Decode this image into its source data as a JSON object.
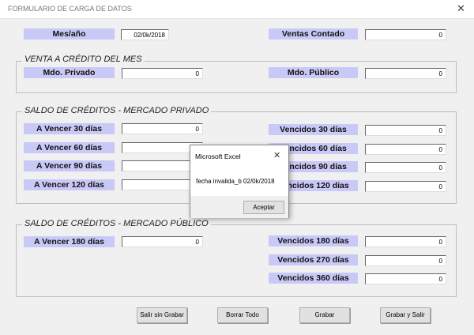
{
  "window": {
    "title": "FORMULARIO DE CARGA DE DATOS",
    "close_icon": "close-icon"
  },
  "top": {
    "mes_label": "Mes/año",
    "mes_value": "02/0k/2018",
    "ventas_label": "Ventas Contado",
    "ventas_value": "0"
  },
  "venta_credito": {
    "title": "VENTA A CRÉDITO DEL MES",
    "privado_label": "Mdo. Privado",
    "privado_value": "0",
    "publico_label": "Mdo. Público",
    "publico_value": "0"
  },
  "privado": {
    "title": "SALDO DE CRÉDITOS - MERCADO PRIVADO",
    "left": [
      {
        "label": "A Vencer 30 días",
        "value": "0"
      },
      {
        "label": "A Vencer 60 días",
        "value": ""
      },
      {
        "label": "A Vencer 90 días",
        "value": ""
      },
      {
        "label": "A Vencer 120 días",
        "value": ""
      }
    ],
    "right": [
      {
        "label": "Vencidos 30 días",
        "value": "0"
      },
      {
        "label": "Vencidos 60 días",
        "value": "0"
      },
      {
        "label": "Vencidos 90 días",
        "value": "0"
      },
      {
        "label": "Vencidos 120 días",
        "value": "0"
      }
    ]
  },
  "publico": {
    "title": "SALDO DE CRÉDITOS - MERCADO PÚBLICO",
    "left": [
      {
        "label": "A Vencer 180 días",
        "value": "0"
      }
    ],
    "right": [
      {
        "label": "Vencidos 180 días",
        "value": "0"
      },
      {
        "label": "Vencidos 270 días",
        "value": "0"
      },
      {
        "label": "Vencidos 360 días",
        "value": "0"
      }
    ]
  },
  "buttons": {
    "salir": "Salir sin Grabar",
    "borrar": "Borrar Todo",
    "grabar": "Grabar",
    "grabar_salir": "Grabar y Salir"
  },
  "dialog": {
    "title": "Microsoft Excel",
    "message": "fecha invalida_b 02/0k/2018",
    "ok": "Aceptar"
  }
}
